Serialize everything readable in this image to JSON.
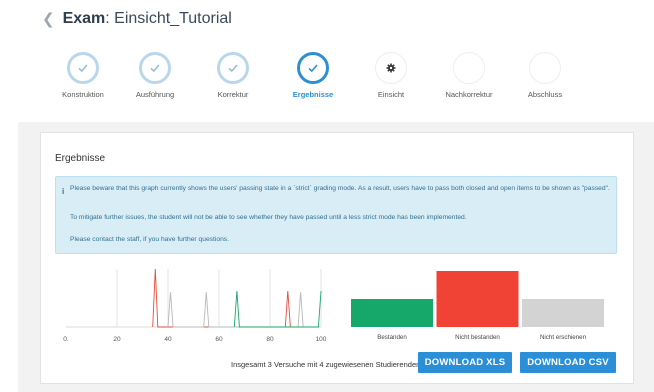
{
  "header": {
    "title_prefix": "Exam",
    "title_name": ": Einsicht_Tutorial"
  },
  "steps": [
    {
      "label": "Konstruktion",
      "state": "done"
    },
    {
      "label": "Ausführung",
      "state": "done"
    },
    {
      "label": "Korrektur",
      "state": "done"
    },
    {
      "label": "Ergebnisse",
      "state": "current"
    },
    {
      "label": "Einsicht",
      "state": "active"
    },
    {
      "label": "Nachkorrektur",
      "state": "future"
    },
    {
      "label": "Abschluss",
      "state": "future"
    }
  ],
  "card": {
    "title": "Ergebnisse"
  },
  "alert": {
    "paragraph1": "Please beware that this graph currently shows the users' passing state in a `strict` grading mode. As a result, users have to pass both closed and open items to be shown as \"passed\".",
    "paragraph2": "To mitigate further issues, the student will not be able to see whether they have passed until a less strict mode has been implemented.",
    "paragraph3": "Please contact the staff, if you have further questions."
  },
  "chart_data": [
    {
      "type": "line",
      "xlabel": "",
      "ylabel": "",
      "xlim": [
        0,
        100
      ],
      "x_ticks": [
        "0",
        "20",
        "40",
        "60",
        "80",
        "100"
      ],
      "grid": true,
      "series": [
        {
          "color": "#e74c3c",
          "x": [
            34,
            35,
            36,
            86,
            87,
            88
          ],
          "values": [
            0,
            1.0,
            0,
            0,
            0.62,
            0
          ]
        },
        {
          "color": "#b8b8b8",
          "x": [
            40,
            41,
            42,
            54,
            55,
            56,
            91,
            92,
            93
          ],
          "values": [
            0,
            0.6,
            0,
            0,
            0.6,
            0,
            0,
            0.6,
            0
          ]
        },
        {
          "color": "#16a86a",
          "x": [
            66,
            67,
            68,
            99,
            100
          ],
          "values": [
            0,
            0.62,
            0,
            0,
            0.62
          ]
        }
      ]
    },
    {
      "type": "bar",
      "categories": [
        "Bestanden",
        "Nicht bestanden",
        "Nicht erschienen"
      ],
      "values": [
        1,
        2,
        1
      ],
      "colors": [
        "#16a86a",
        "#f14236",
        "#d3d3d3"
      ]
    }
  ],
  "footer": {
    "summary": "Insgesamt 3 Versuche mit 4 zugewiesenen Studierenden",
    "download_xls": "DOWNLOAD XLS",
    "download_csv": "DOWNLOAD CSV"
  },
  "icons": {
    "back": "chevron-left-icon",
    "done": "check-icon",
    "active": "gear-icon"
  }
}
